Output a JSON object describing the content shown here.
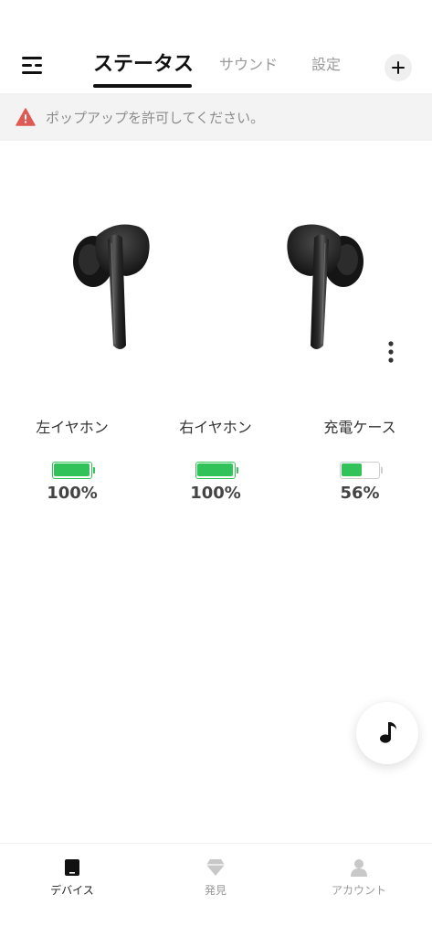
{
  "header": {
    "tabs": [
      {
        "label": "ステータス",
        "active": true
      },
      {
        "label": "サウンド",
        "active": false
      },
      {
        "label": "設定",
        "active": false
      }
    ]
  },
  "banner": {
    "text": "ポップアップを許可してください。",
    "icon": "warning-icon",
    "icon_color": "#e05a55"
  },
  "battery": {
    "left": {
      "label": "左イヤホン",
      "value": "100%",
      "level": 1.0
    },
    "right": {
      "label": "右イヤホン",
      "value": "100%",
      "level": 1.0
    },
    "case": {
      "label": "充電ケース",
      "value": "56%",
      "level": 0.56
    }
  },
  "fab": {
    "icon": "music-note-icon"
  },
  "bottom_nav": {
    "items": [
      {
        "label": "デバイス",
        "icon": "device-icon",
        "active": true
      },
      {
        "label": "発見",
        "icon": "diamond-icon",
        "active": false
      },
      {
        "label": "アカウント",
        "icon": "account-icon",
        "active": false
      }
    ]
  },
  "colors": {
    "accent": "#31c35a",
    "text_primary": "#111111",
    "text_muted": "#9a9a9a",
    "banner_bg": "#f3f3f3"
  }
}
